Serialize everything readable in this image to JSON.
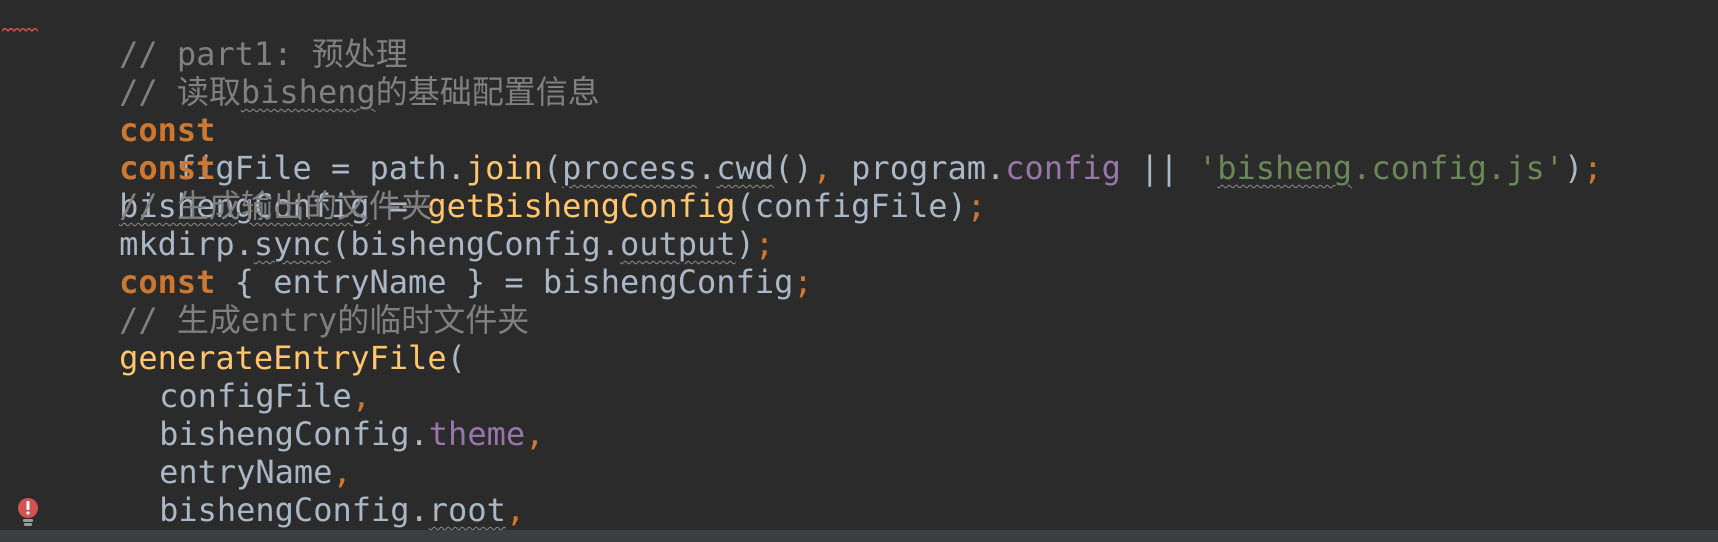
{
  "code": {
    "line1": {
      "comment": "// part1: 预处理"
    },
    "line2": {
      "comment_a": "// 读取",
      "comment_word": "bisheng",
      "comment_b": "的基础配置信息"
    },
    "line3": {
      "kw": "const",
      "ident": "configFile",
      "eq": " = ",
      "obj": "path",
      "dot1": ".",
      "fn": "join",
      "p_open": "(",
      "obj2": "process",
      "dot2": ".",
      "fn2": "cwd",
      "call": "()",
      "comma": ",",
      "sp": " ",
      "obj3": "program",
      "dot3": ".",
      "prop": "config",
      "or": " || ",
      "str_q1": "'",
      "str_word": "bisheng",
      "str_rest": ".config.js'",
      "p_close": ")",
      "semi": ";"
    },
    "line4": {
      "kw": "const",
      "ident": "bishengConfig",
      "eq": " = ",
      "fn": "getBishengConfig",
      "args": "(configFile)",
      "semi": ";"
    },
    "line5": {
      "comment": "// 生成输出的文件夹"
    },
    "line6": {
      "obj": "mkdirp",
      "dot": ".",
      "fn": "sync",
      "open": "(bishengConfig.",
      "prop": "output",
      "close": ")",
      "semi": ";"
    },
    "line7": {
      "kw": "const",
      "destructure": " { entryName } = bishengConfig",
      "semi": ";"
    },
    "line8": {
      "comment": "// 生成entry的临时文件夹"
    },
    "line9": {
      "fn": "generateEntryFile",
      "open": "("
    },
    "line10": {
      "arg": "configFile",
      "comma": ","
    },
    "line11": {
      "obj": "bishengConfig.",
      "prop": "theme",
      "comma": ","
    },
    "line12": {
      "arg": "entryName",
      "comma": ","
    },
    "line13": {
      "obj": "bishengConfig.",
      "prop": "root",
      "comma": ","
    },
    "line14": {
      "close": ")",
      "semi": ";"
    }
  },
  "gutter": {
    "error_marker_icon": "error-squiggle-icon",
    "intention_icon": "lightbulb-warning-icon",
    "intention_color": "#d25252"
  },
  "theme": {
    "background": "#2b2b2b",
    "default_text": "#a9b7c6",
    "keyword": "#cc7832",
    "function": "#ffc66d",
    "property": "#9876aa",
    "string": "#6a8759",
    "comment": "#808080"
  }
}
